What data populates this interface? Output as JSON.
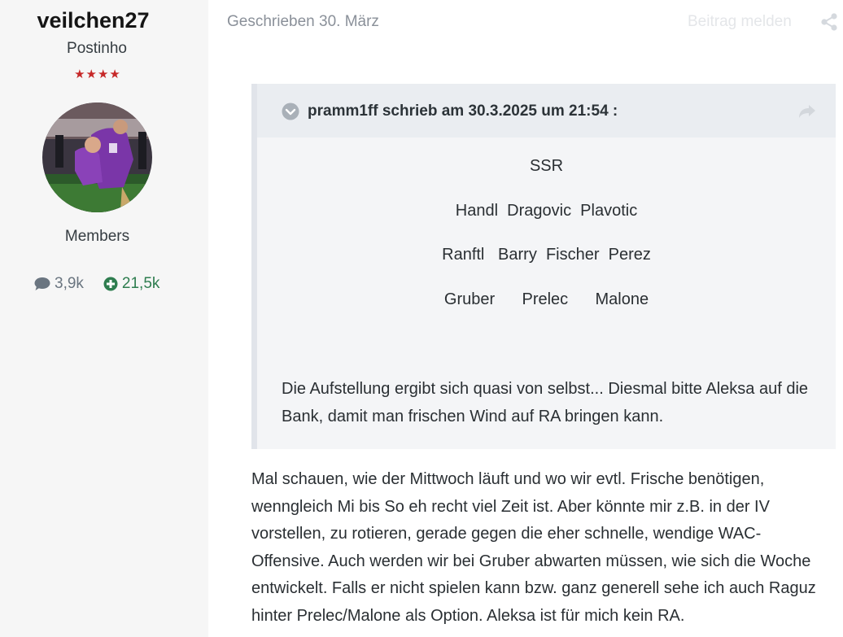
{
  "author": {
    "username": "veilchen27",
    "rank_title": "Postinho",
    "rank_stars": "★★★★",
    "group": "Members",
    "posts_count": "3,9k",
    "reputation": "21,5k"
  },
  "post": {
    "date_label": "Geschrieben 30. März",
    "report_label": "Beitrag melden"
  },
  "quote": {
    "citation": "pramm1ff schrieb am 30.3.2025 um 21:54 :",
    "lineup": [
      "SSR",
      "Handl  Dragovic  Plavotic",
      "Ranftl   Barry  Fischer  Perez",
      "Gruber      Prelec      Malone"
    ],
    "text": "Die Aufstellung ergibt sich quasi von selbst... Diesmal bitte Aleksa auf die Bank, damit man frischen Wind auf RA bringen kann."
  },
  "reply": {
    "text": "Mal schauen, wie der Mittwoch läuft und wo wir evtl. Frische benötigen, wenngleich Mi bis So eh recht viel Zeit ist. Aber könnte mir z.B. in der IV vorstellen, zu rotieren, gerade gegen die eher schnelle, wendige WAC-Offensive. Auch werden wir bei Gruber abwarten müssen, wie sich die Woche entwickelt. Falls er nicht spielen kann bzw. ganz generell sehe ich auch Raguz hinter Prelec/Malone als Option. Aleksa ist für mich kein RA."
  },
  "icons": {
    "posts": "comment-icon",
    "reputation": "plus-circle-icon",
    "share": "share-icon",
    "toggle": "chevron-down-circle-icon",
    "jump": "reply-arrow-icon"
  },
  "colors": {
    "reputation_green": "#2e7d4f",
    "stars_red": "#c62828",
    "sidebar_bg": "#f6f6f6",
    "quote_bg": "#f4f5f7"
  }
}
